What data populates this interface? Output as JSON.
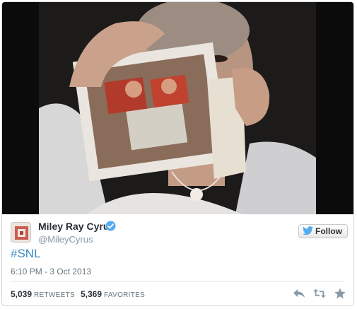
{
  "user": {
    "name": "Miley Ray Cyrus",
    "handle": "@MileyCyrus",
    "verified": true
  },
  "follow_button": {
    "label": "Follow",
    "icon": "twitter-bird-icon"
  },
  "tweet": {
    "text": "#SNL",
    "timestamp": "6:10 PM - 3 Oct 2013"
  },
  "stats": {
    "retweets_count": "5,039",
    "retweets_label": "RETWEETS",
    "favorites_count": "5,369",
    "favorites_label": "FAVORITES"
  },
  "actions": [
    "reply-icon",
    "retweet-icon",
    "favorite-icon"
  ],
  "colors": {
    "link": "#3b88c3",
    "verified": "#55acee",
    "meta_text": "#66757f",
    "name_text": "#292f33"
  }
}
